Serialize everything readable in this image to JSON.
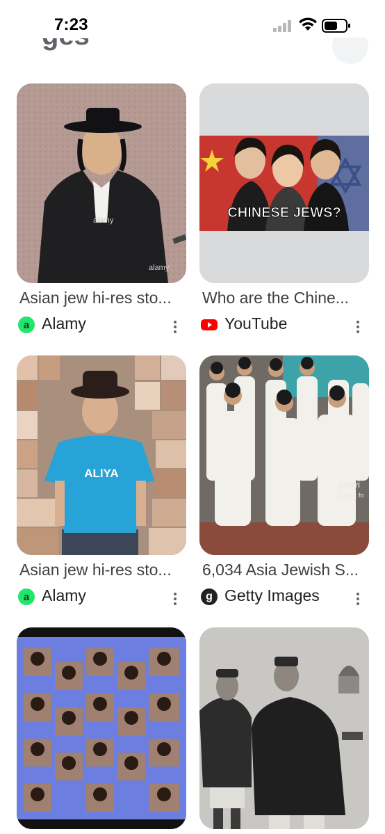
{
  "status_bar": {
    "time": "7:23"
  },
  "header": {
    "partial_title": "ges"
  },
  "results": [
    {
      "caption": "Asian jew hi-res sto...",
      "source": "Alamy",
      "source_icon": "alamy-icon",
      "source_icon_glyph": "a",
      "watermark": "alamy"
    },
    {
      "caption": "Who are the Chine...",
      "source": "YouTube",
      "source_icon": "youtube-icon",
      "overlay_text": "CHINESE JEWS?"
    },
    {
      "caption": "Asian jew hi-res sto...",
      "source": "Alamy",
      "source_icon": "alamy-icon",
      "source_icon_glyph": "a",
      "shirt_text": "ALIYA"
    },
    {
      "caption": "6,034 Asia Jewish S...",
      "source": "Getty Images",
      "source_icon": "getty-icon",
      "source_icon_glyph": "g",
      "watermark": "gettyi",
      "credit": "Credit: fo"
    },
    {
      "caption": "",
      "source": ""
    },
    {
      "caption": "",
      "source": ""
    }
  ],
  "colors": {
    "alamy_green": "#22e56b",
    "youtube_red": "#ff0000",
    "caption_text": "#3c4043",
    "placeholder_gray": "#d9dadc"
  }
}
